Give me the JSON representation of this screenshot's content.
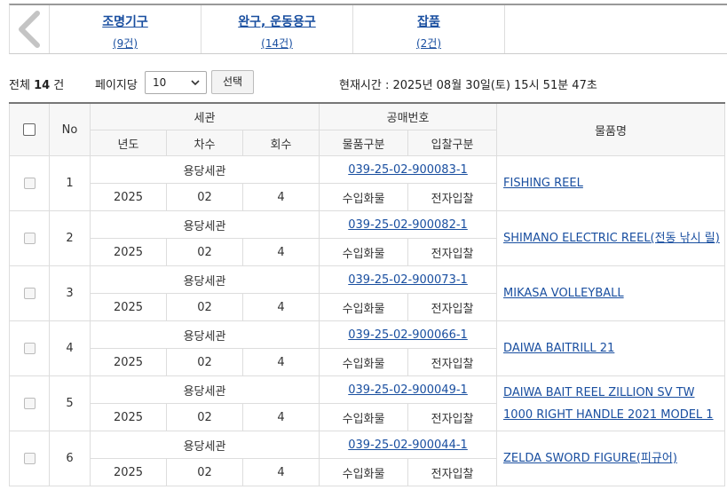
{
  "categories": [
    {
      "name": "조명기구",
      "count": "(9건)"
    },
    {
      "name": "완구, 운동용구",
      "count": "(14건)"
    },
    {
      "name": "잡품",
      "count": "(2건)"
    }
  ],
  "toolbar": {
    "total_prefix": "전체",
    "total_count": "14",
    "total_suffix": "건",
    "perpage_label": "페이지당",
    "perpage_value": "10",
    "select_label": "선택",
    "current_time": "현재시간 : 2025년 08월 30일(토) 15시 51분 47초"
  },
  "table": {
    "headers": {
      "no": "No",
      "customs": "세관",
      "auction_no": "공매번호",
      "item_name": "물품명",
      "year": "년도",
      "round": "차수",
      "times": "회수",
      "item_type": "물품구분",
      "bid_type": "입찰구분"
    },
    "rows": [
      {
        "no": "1",
        "customs": "용당세관",
        "auction_no": "039-25-02-900083-1",
        "year": "2025",
        "round": "02",
        "times": "4",
        "item_type": "수입화물",
        "bid_type": "전자입찰",
        "name": "FISHING REEL"
      },
      {
        "no": "2",
        "customs": "용당세관",
        "auction_no": "039-25-02-900082-1",
        "year": "2025",
        "round": "02",
        "times": "4",
        "item_type": "수입화물",
        "bid_type": "전자입찰",
        "name": "SHIMANO ELECTRIC REEL(전동 낚시 릴)"
      },
      {
        "no": "3",
        "customs": "용당세관",
        "auction_no": "039-25-02-900073-1",
        "year": "2025",
        "round": "02",
        "times": "4",
        "item_type": "수입화물",
        "bid_type": "전자입찰",
        "name": "MIKASA VOLLEYBALL"
      },
      {
        "no": "4",
        "customs": "용당세관",
        "auction_no": "039-25-02-900066-1",
        "year": "2025",
        "round": "02",
        "times": "4",
        "item_type": "수입화물",
        "bid_type": "전자입찰",
        "name": "DAIWA BAITRILL 21"
      },
      {
        "no": "5",
        "customs": "용당세관",
        "auction_no": "039-25-02-900049-1",
        "year": "2025",
        "round": "02",
        "times": "4",
        "item_type": "수입화물",
        "bid_type": "전자입찰",
        "name": "DAIWA BAIT REEL ZILLION SV TW 1000 RIGHT HANDLE 2021 MODEL 1"
      },
      {
        "no": "6",
        "customs": "용당세관",
        "auction_no": "039-25-02-900044-1",
        "year": "2025",
        "round": "02",
        "times": "4",
        "item_type": "수입화물",
        "bid_type": "전자입찰",
        "name": "ZELDA SWORD FIGURE(피규어)"
      }
    ]
  }
}
